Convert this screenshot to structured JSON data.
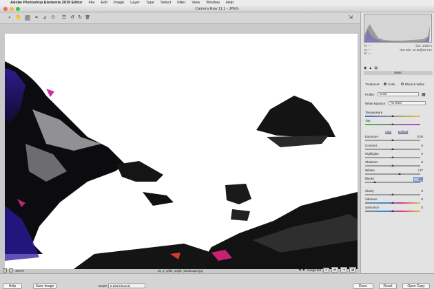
{
  "menubar": {
    "apple": "",
    "app_name": "Adobe Photoshop Elements 2019 Editor",
    "items": [
      "File",
      "Edit",
      "Image",
      "Layer",
      "Type",
      "Select",
      "Filter",
      "View",
      "Window",
      "Help"
    ]
  },
  "window": {
    "title": "Camera Raw 11.1  -  JPEG"
  },
  "toolbar": {
    "tools": [
      {
        "name": "zoom-tool-icon",
        "glyph": "⌕"
      },
      {
        "name": "hand-tool-icon",
        "glyph": "✋"
      },
      {
        "name": "white-balance-tool-icon",
        "glyph": "⁄"
      },
      {
        "name": "crop-tool-icon",
        "glyph": "⌗"
      },
      {
        "name": "straighten-tool-icon",
        "glyph": "⊿"
      },
      {
        "name": "red-eye-tool-icon",
        "glyph": "⊙"
      },
      {
        "name": "preferences-icon",
        "glyph": "☰"
      },
      {
        "name": "rotate-left-icon",
        "glyph": "↺"
      },
      {
        "name": "rotate-right-icon",
        "glyph": "↻"
      },
      {
        "name": "trash-icon",
        "glyph": "🗑"
      }
    ],
    "fullscreen_glyph": "⇲"
  },
  "preview": {
    "zoom": "19.6%",
    "filename": "p5_2_wide_angle_landscape.jpg",
    "image_label": "Image 6/6",
    "y_glyph": "Y",
    "nav_prev": "◀",
    "nav_next": "▶"
  },
  "info": {
    "r_label": "R:",
    "r_val": "---",
    "g_label": "G:",
    "g_val": "---",
    "b_label": "B:",
    "b_val": "---",
    "aperture": "f/16",
    "shutter": "1/200 s",
    "iso": "ISO 400",
    "lens": "16-35@29 mm"
  },
  "panel": {
    "section": "Basic",
    "treatment_label": "Treatment:",
    "treatment_color": "Color",
    "treatment_bw": "Black & White",
    "profile_label": "Profile:",
    "profile_value": "Color",
    "wb_label": "White Balance:",
    "wb_value": "As Shot",
    "auto_label": "Auto",
    "default_label": "Default",
    "sliders": [
      {
        "key": "temperature",
        "label": "Temperature",
        "value": "",
        "pos": 0.5
      },
      {
        "key": "tint",
        "label": "Tint",
        "value": "",
        "pos": 0.5
      },
      {
        "key": "exposure",
        "label": "Exposure",
        "value": "0.00",
        "pos": 0.5
      },
      {
        "key": "contrast",
        "label": "Contrast",
        "value": "0",
        "pos": 0.5
      },
      {
        "key": "highlights",
        "label": "Highlights",
        "value": "0",
        "pos": 0.5
      },
      {
        "key": "shadows",
        "label": "Shadows",
        "value": "0",
        "pos": 0.5
      },
      {
        "key": "whites",
        "label": "Whites",
        "value": "+27",
        "pos": 0.63
      },
      {
        "key": "blacks",
        "label": "Blacks",
        "value": "-65",
        "pos": 0.17
      },
      {
        "key": "clarity",
        "label": "Clarity",
        "value": "0",
        "pos": 0.5
      },
      {
        "key": "vibrance",
        "label": "Vibrance",
        "value": "0",
        "pos": 0.5
      },
      {
        "key": "saturation",
        "label": "Saturation",
        "value": "0",
        "pos": 0.5
      }
    ]
  },
  "bottom": {
    "help": "Help",
    "save": "Save Image",
    "depth_label": "Depth:",
    "depth_value": "8 Bits/Channel",
    "done": "Done",
    "reset": "Reset",
    "open_copy": "Open Copy"
  },
  "colors": {
    "temp_gradient": [
      "#3a6fd0",
      "#e8c23a"
    ],
    "tint_gradient": [
      "#3fbf4a",
      "#c93cc9"
    ],
    "highlight_value": "#a7c4ea"
  }
}
